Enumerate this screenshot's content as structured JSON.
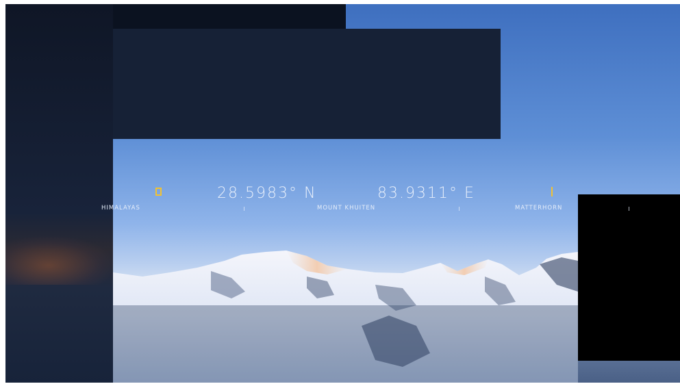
{
  "hud": {
    "latitude": "28.5983° N",
    "longitude": "83.9311° E",
    "places": [
      "HIMALAYAS",
      "MOUNT KHUITEN",
      "MATTERHORN"
    ]
  },
  "colors": {
    "accent": "#f2c230",
    "text": "#e9f0fb",
    "sky": "#5e8fd6"
  },
  "icons": [
    "yellow-frame-icon",
    "yellow-bar-icon"
  ]
}
